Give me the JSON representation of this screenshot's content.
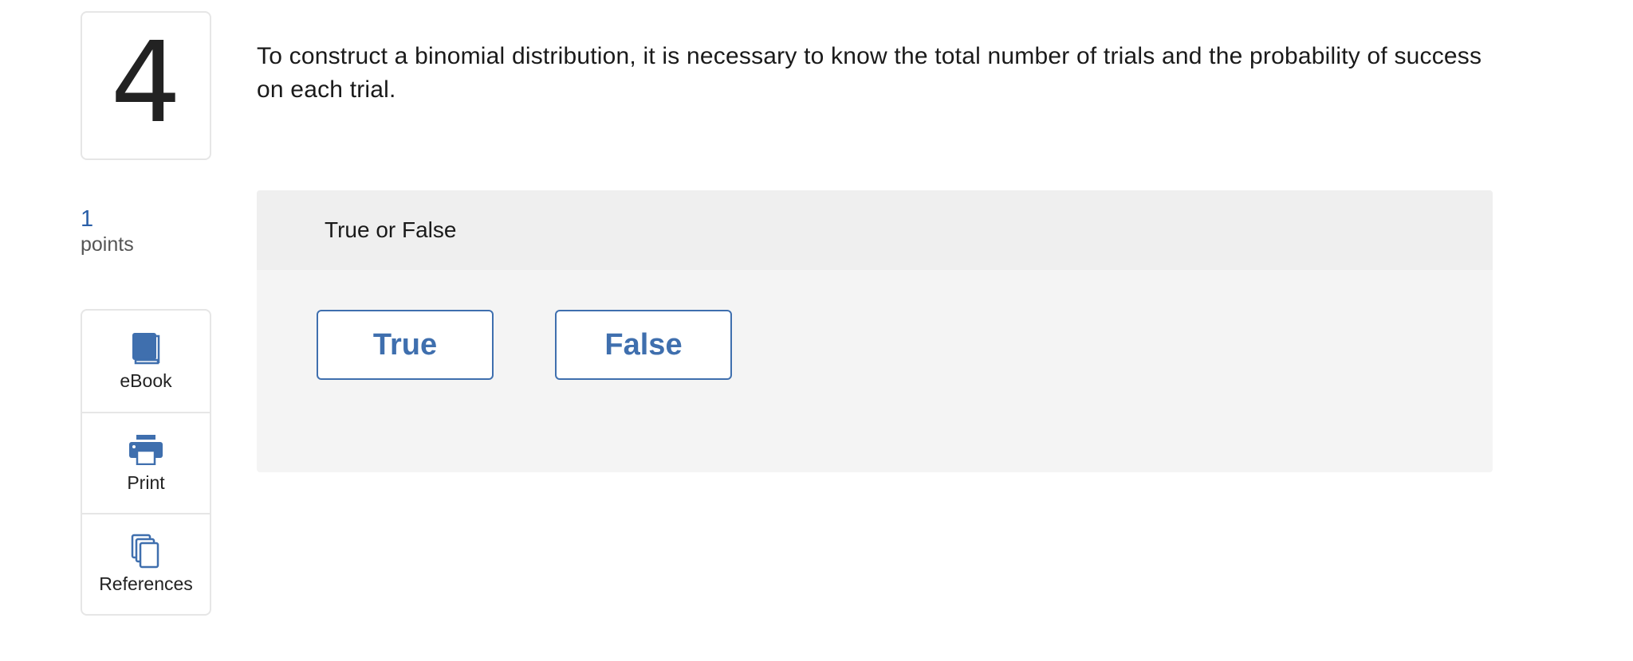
{
  "question": {
    "number": "4",
    "prompt": "To construct a binomial distribution, it is necessary to know the total number of trials and the probability of success on each trial."
  },
  "points": {
    "value": "1",
    "label": "points"
  },
  "tools": {
    "ebook": "eBook",
    "print": "Print",
    "references": "References"
  },
  "answer": {
    "type_label": "True or False",
    "options": [
      "True",
      "False"
    ]
  },
  "colors": {
    "accent": "#3f6fae",
    "points_value": "#2a5fa8",
    "panel_bg": "#f4f4f4",
    "panel_header_bg": "#efefef"
  },
  "icons": {
    "ebook": "book-icon",
    "print": "printer-icon",
    "references": "copy-documents-icon"
  }
}
